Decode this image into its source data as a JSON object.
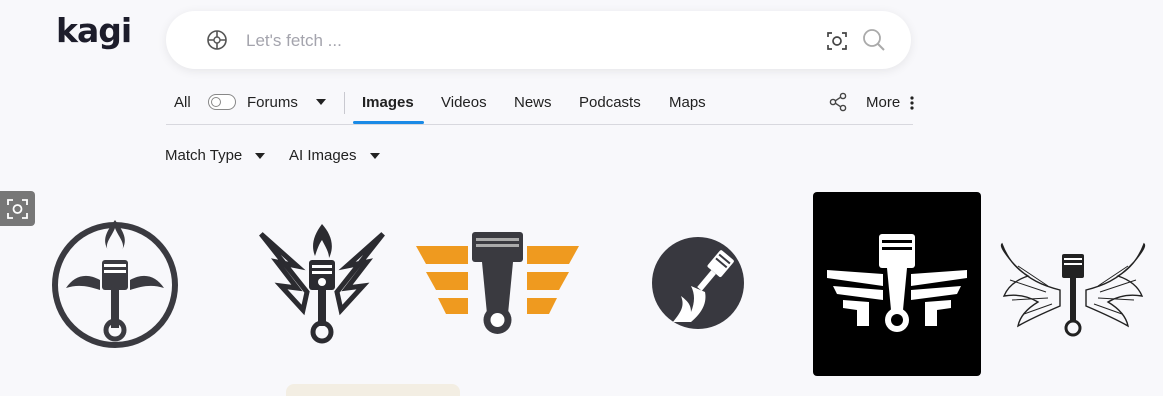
{
  "brand": {
    "logo_text": "kagi"
  },
  "search": {
    "placeholder": "Let's fetch ...",
    "value": ""
  },
  "nav": {
    "tabs": [
      {
        "label": "All"
      },
      {
        "label": "Forums"
      },
      {
        "label": "Images",
        "active": true
      },
      {
        "label": "Videos"
      },
      {
        "label": "News"
      },
      {
        "label": "Podcasts"
      },
      {
        "label": "Maps"
      }
    ],
    "more_label": "More",
    "active_color": "#1a8ae6"
  },
  "filters": [
    {
      "label": "Match Type"
    },
    {
      "label": "AI Images"
    }
  ],
  "results": {
    "images": [
      {
        "icon": "piston-winged-flame-circle-icon"
      },
      {
        "icon": "piston-flame-wings-icon"
      },
      {
        "icon": "piston-orange-stripes-icon"
      },
      {
        "icon": "piston-flame-dark-circle-icon"
      },
      {
        "icon": "piston-wings-black-square-icon"
      },
      {
        "icon": "piston-feathered-wings-icon"
      }
    ]
  },
  "colors": {
    "accent": "#1a8ae6",
    "orange": "#ef9a1f",
    "dark": "#3a3a40"
  }
}
